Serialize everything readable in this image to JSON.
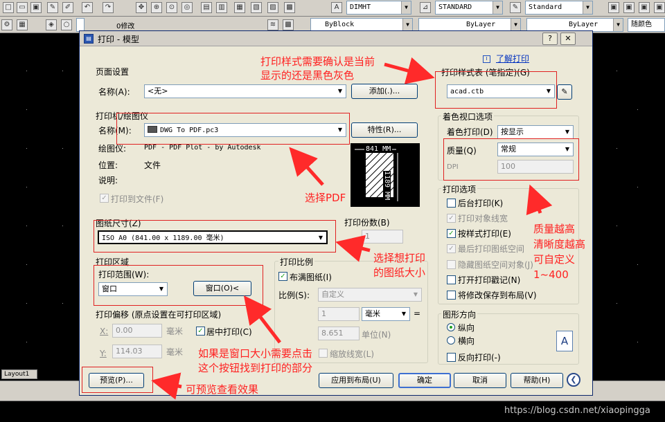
{
  "app": {
    "toolbar_combos": [
      "DIMHT",
      "STANDARD",
      "Standard"
    ],
    "layer_name": "0修改",
    "byblock": "ByBlock",
    "bylayer1": "ByLayer",
    "bylayer2": "ByLayer",
    "color_label": "随颜色",
    "layout_tab": "Layout1",
    "watermark": "https://blog.csdn.net/xiaopingga"
  },
  "dialog": {
    "title": "打印 - 模型",
    "help_link": "了解打印",
    "page_setup": {
      "label": "页面设置",
      "name_label": "名称(A):",
      "name_value": "<无>",
      "add_button": "添加(.)..."
    },
    "printer": {
      "label": "打印机/绘图仪",
      "name_label": "名称(M):",
      "name_value": "DWG To PDF.pc3",
      "properties_button": "特性(R)...",
      "plotter_label": "绘图仪:",
      "plotter_value": "PDF - PDF Plot - by Autodesk",
      "location_label": "位置:",
      "location_value": "文件",
      "description_label": "说明:",
      "plot_to_file": "打印到文件(F)",
      "preview_width": "841 MM",
      "preview_height": "1189 MM"
    },
    "paper_size": {
      "label": "图纸尺寸(Z)",
      "value": "ISO A0 (841.00 x 1189.00 毫米)"
    },
    "copies": {
      "label": "打印份数(B)",
      "value": "1"
    },
    "plot_area": {
      "label": "打印区域",
      "range_label": "打印范围(W):",
      "range_value": "窗口",
      "window_button": "窗口(O)<"
    },
    "plot_offset": {
      "label": "打印偏移 (原点设置在可打印区域)",
      "x_label": "X:",
      "x_value": "0.00",
      "y_label": "Y:",
      "y_value": "114.03",
      "unit": "毫米",
      "center_plot": "居中打印(C)"
    },
    "plot_scale": {
      "label": "打印比例",
      "fit_paper": "布满图纸(I)",
      "scale_label": "比例(S):",
      "scale_value": "自定义",
      "value1": "1",
      "unit_value": "毫米",
      "value2": "8.651",
      "unit_label": "单位(N)",
      "scale_lineweights": "缩放线宽(L)"
    },
    "plot_style_table": {
      "label": "打印样式表 (笔指定)(G)",
      "value": "acad.ctb"
    },
    "shaded_viewport": {
      "label": "着色视口选项",
      "shade_label": "着色打印(D)",
      "shade_value": "按显示",
      "quality_label": "质量(Q)",
      "quality_value": "常规",
      "dpi_label": "DPI",
      "dpi_value": "100"
    },
    "plot_options": {
      "label": "打印选项",
      "items": [
        {
          "label": "后台打印(K)",
          "checked": false,
          "disabled": false
        },
        {
          "label": "打印对象线宽",
          "checked": true,
          "disabled": true
        },
        {
          "label": "按样式打印(E)",
          "checked": true,
          "disabled": false
        },
        {
          "label": "最后打印图纸空间",
          "checked": true,
          "disabled": true
        },
        {
          "label": "隐藏图纸空间对象(J)",
          "checked": false,
          "disabled": true
        },
        {
          "label": "打开打印戳记(N)",
          "checked": false,
          "disabled": false
        },
        {
          "label": "将修改保存到布局(V)",
          "checked": false,
          "disabled": false
        }
      ]
    },
    "orientation": {
      "label": "图形方向",
      "portrait": "纵向",
      "landscape": "横向",
      "reverse": "反向打印(-)",
      "icon_letter": "A"
    },
    "buttons": {
      "preview": "预览(P)...",
      "apply": "应用到布局(U)",
      "ok": "确定",
      "cancel": "取消",
      "help": "帮助(H)"
    }
  },
  "annotations": {
    "style_note": [
      "打印样式需要确认是当前",
      "显示的还是黑色灰色"
    ],
    "pdf_note": "选择PDF",
    "paper_note": [
      "选择想打印",
      "的图纸大小"
    ],
    "quality_note": [
      "质量越高",
      "清晰度越高",
      "可自定义",
      "1~400"
    ],
    "window_note": [
      "如果是窗口大小需要点击",
      "这个按钮找到打印的部分"
    ],
    "preview_note": "可预览查看效果"
  }
}
